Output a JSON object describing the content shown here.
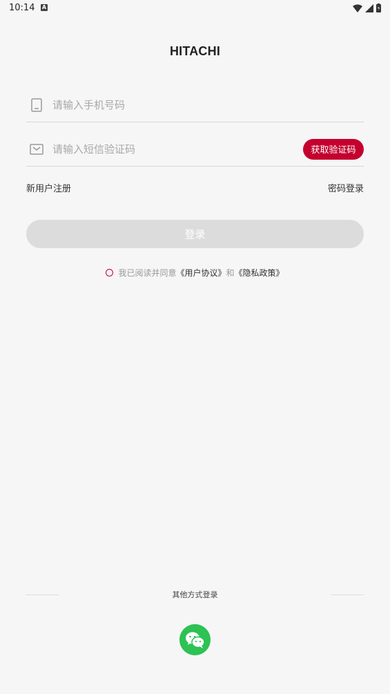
{
  "status_bar": {
    "time": "10:14",
    "notification_icon": "a-icon"
  },
  "logo": {
    "text": "HITACHI"
  },
  "phone_field": {
    "placeholder": "请输入手机号码",
    "icon": "phone-icon"
  },
  "code_field": {
    "placeholder": "请输入短信验证码",
    "icon": "mail-icon",
    "button_label": "获取验证码"
  },
  "links": {
    "register": "新用户注册",
    "password_login": "密码登录"
  },
  "login_button": {
    "label": "登录"
  },
  "agreement": {
    "prefix": "我已阅读并同意",
    "user_agreement": "《用户协议》",
    "and": "和",
    "privacy_policy": "《隐私政策》"
  },
  "other_login": {
    "label": "其他方式登录",
    "wechat_icon": "wechat-icon"
  },
  "colors": {
    "accent": "#c4002f",
    "wechat": "#2dc254",
    "background": "#f6f6f6",
    "disabled_button": "#dcdcdc"
  }
}
